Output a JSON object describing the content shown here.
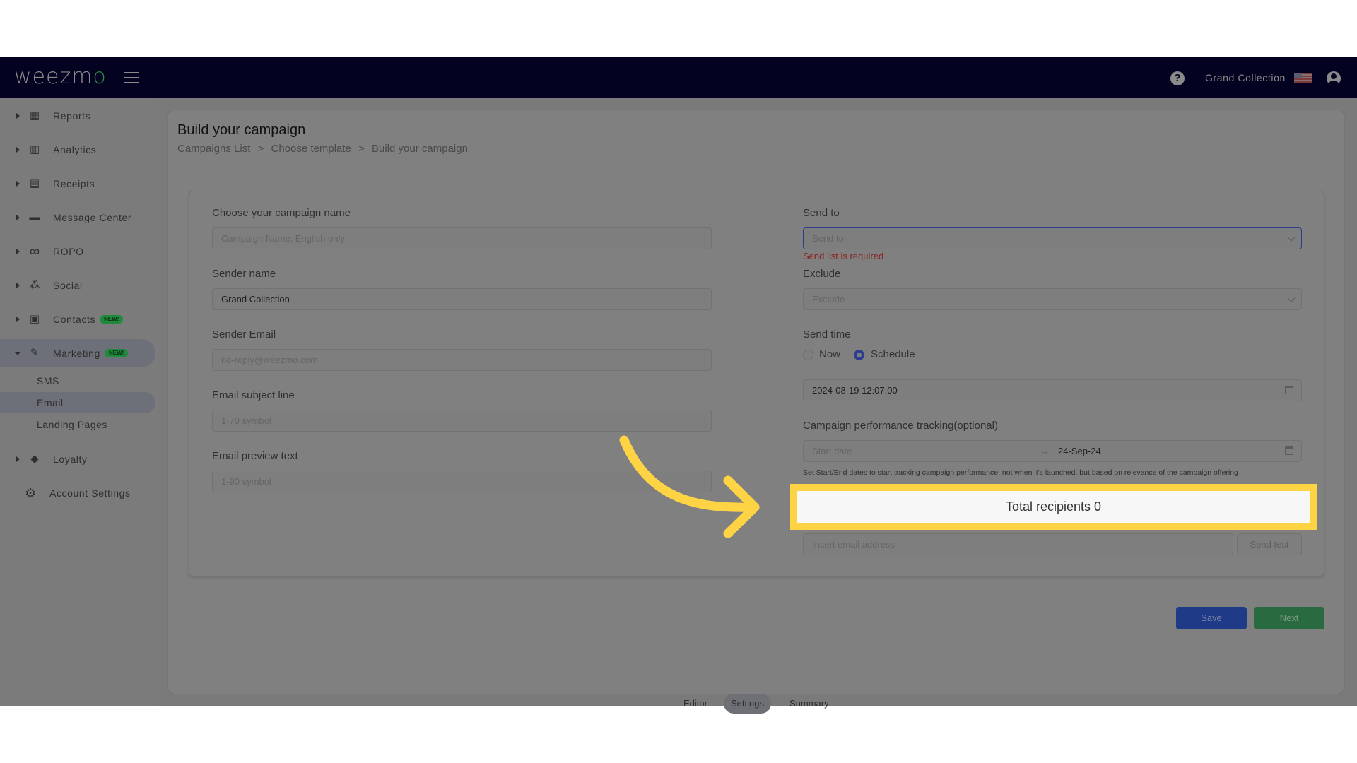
{
  "header": {
    "logo": "weezm",
    "logo_accent": "o",
    "account_name": "Grand Collection",
    "icons": {
      "menu": "hamburger-icon",
      "help": "question-circle-icon",
      "flag": "us-flag-icon",
      "user": "account-circle-icon"
    }
  },
  "sidebar": {
    "items": [
      {
        "label": "Reports",
        "icon": "dashboard-icon",
        "glyph": "▦"
      },
      {
        "label": "Analytics",
        "icon": "analytics-icon",
        "glyph": "▥"
      },
      {
        "label": "Receipts",
        "icon": "receipt-icon",
        "glyph": "▤"
      },
      {
        "label": "Message Center",
        "icon": "chat-icon",
        "glyph": "▬"
      },
      {
        "label": "ROPO",
        "icon": "infinity-icon",
        "glyph": "∞"
      },
      {
        "label": "Social",
        "icon": "groups-icon",
        "glyph": "⁂"
      },
      {
        "label": "Contacts",
        "icon": "contacts-icon",
        "glyph": "▣",
        "badge": "NEW!"
      },
      {
        "label": "Marketing",
        "icon": "campaign-icon",
        "glyph": "✎",
        "badge": "NEW!"
      },
      {
        "label": "Loyalty",
        "icon": "loyalty-tag-icon",
        "glyph": "◆"
      },
      {
        "label": "Account Settings",
        "icon": "gear-icon",
        "glyph": "⚙"
      }
    ],
    "marketing_sub": [
      "SMS",
      "Email",
      "Landing Pages"
    ],
    "active_sub": "Email"
  },
  "page": {
    "title": "Build your campaign",
    "breadcrumb": [
      "Campaigns List",
      ">",
      "Choose template",
      ">",
      "Build your campaign"
    ]
  },
  "form": {
    "campaign_name": {
      "label": "Choose your campaign name",
      "placeholder": "Campaign Name, English only",
      "value": ""
    },
    "sender_name": {
      "label": "Sender name",
      "value": "Grand Collection"
    },
    "sender_email": {
      "label": "Sender Email",
      "placeholder": "no-reply@weezmo.com",
      "value": ""
    },
    "subject": {
      "label": "Email subject line",
      "placeholder": "1-70 symbol",
      "value": ""
    },
    "preview": {
      "label": "Email preview text",
      "placeholder": "1-90 symbol",
      "value": ""
    },
    "send_to": {
      "label": "Send to",
      "placeholder": "Send to",
      "error": "Send list is required"
    },
    "exclude": {
      "label": "Exclude",
      "placeholder": "Exclude"
    },
    "send_time": {
      "label": "Send time",
      "options": [
        "Now",
        "Schedule"
      ],
      "selected": "Schedule",
      "datetime": "2024-08-19 12:07:00"
    },
    "tracking": {
      "label": "Campaign performance tracking(optional)",
      "start_placeholder": "Start date",
      "separator": "→",
      "end_value": "24-Sep-24",
      "hint": "Set Start/End dates to start tracking campaign performance, not when it's launched, but based on relevance of the campaign offering"
    },
    "total_recipients": "Total recipients 0",
    "test_email": {
      "placeholder": "Insert email address",
      "button": "Send test"
    }
  },
  "steps": {
    "tabs": [
      "Editor",
      "Settings",
      "Summary"
    ],
    "active": "Settings"
  },
  "actions": {
    "save": "Save",
    "next": "Next"
  },
  "annotation": {
    "color": "#ffd444",
    "highlight": "total-recipients"
  }
}
